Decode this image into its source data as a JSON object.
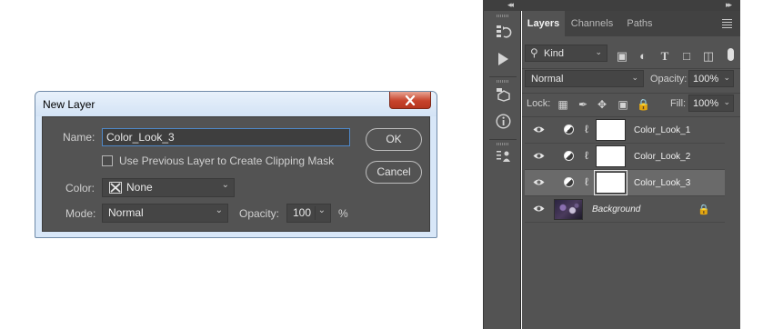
{
  "dialog": {
    "title": "New Layer",
    "close_icon": "close-x-icon",
    "name_label": "Name:",
    "name_value": "Color_Look_3",
    "clipping_label": "Use Previous Layer to Create Clipping Mask",
    "clipping_checked": false,
    "color_label": "Color:",
    "color_value": "None",
    "mode_label": "Mode:",
    "mode_value": "Normal",
    "opacity_label": "Opacity:",
    "opacity_value": "100",
    "opacity_unit": "%",
    "ok_label": "OK",
    "cancel_label": "Cancel"
  },
  "toolstrip": {
    "collapse_left": "◂◂",
    "collapse_right": "▸▸",
    "icons": [
      "history-icon",
      "play-actions-icon",
      "3d-cube-icon",
      "info-icon",
      "properties-icon"
    ]
  },
  "layers_panel": {
    "tabs": [
      {
        "label": "Layers",
        "active": true
      },
      {
        "label": "Channels",
        "active": false
      },
      {
        "label": "Paths",
        "active": false
      }
    ],
    "filter_value": "Kind",
    "blend_mode": "Normal",
    "opacity_label": "Opacity:",
    "opacity_value": "100%",
    "lock_label": "Lock:",
    "fill_label": "Fill:",
    "fill_value": "100%",
    "layers": [
      {
        "name": "Color_Look_1",
        "type": "adjustment",
        "selected": false
      },
      {
        "name": "Color_Look_2",
        "type": "adjustment",
        "selected": false
      },
      {
        "name": "Color_Look_3",
        "type": "adjustment",
        "selected": true
      },
      {
        "name": "Background",
        "type": "image",
        "selected": false,
        "locked": true
      }
    ]
  },
  "colors": {
    "panel_bg": "#535353",
    "dialog_frame": "#d8e7f8",
    "selected_row": "#6a6a6a",
    "focus_border": "#4f88c8"
  }
}
